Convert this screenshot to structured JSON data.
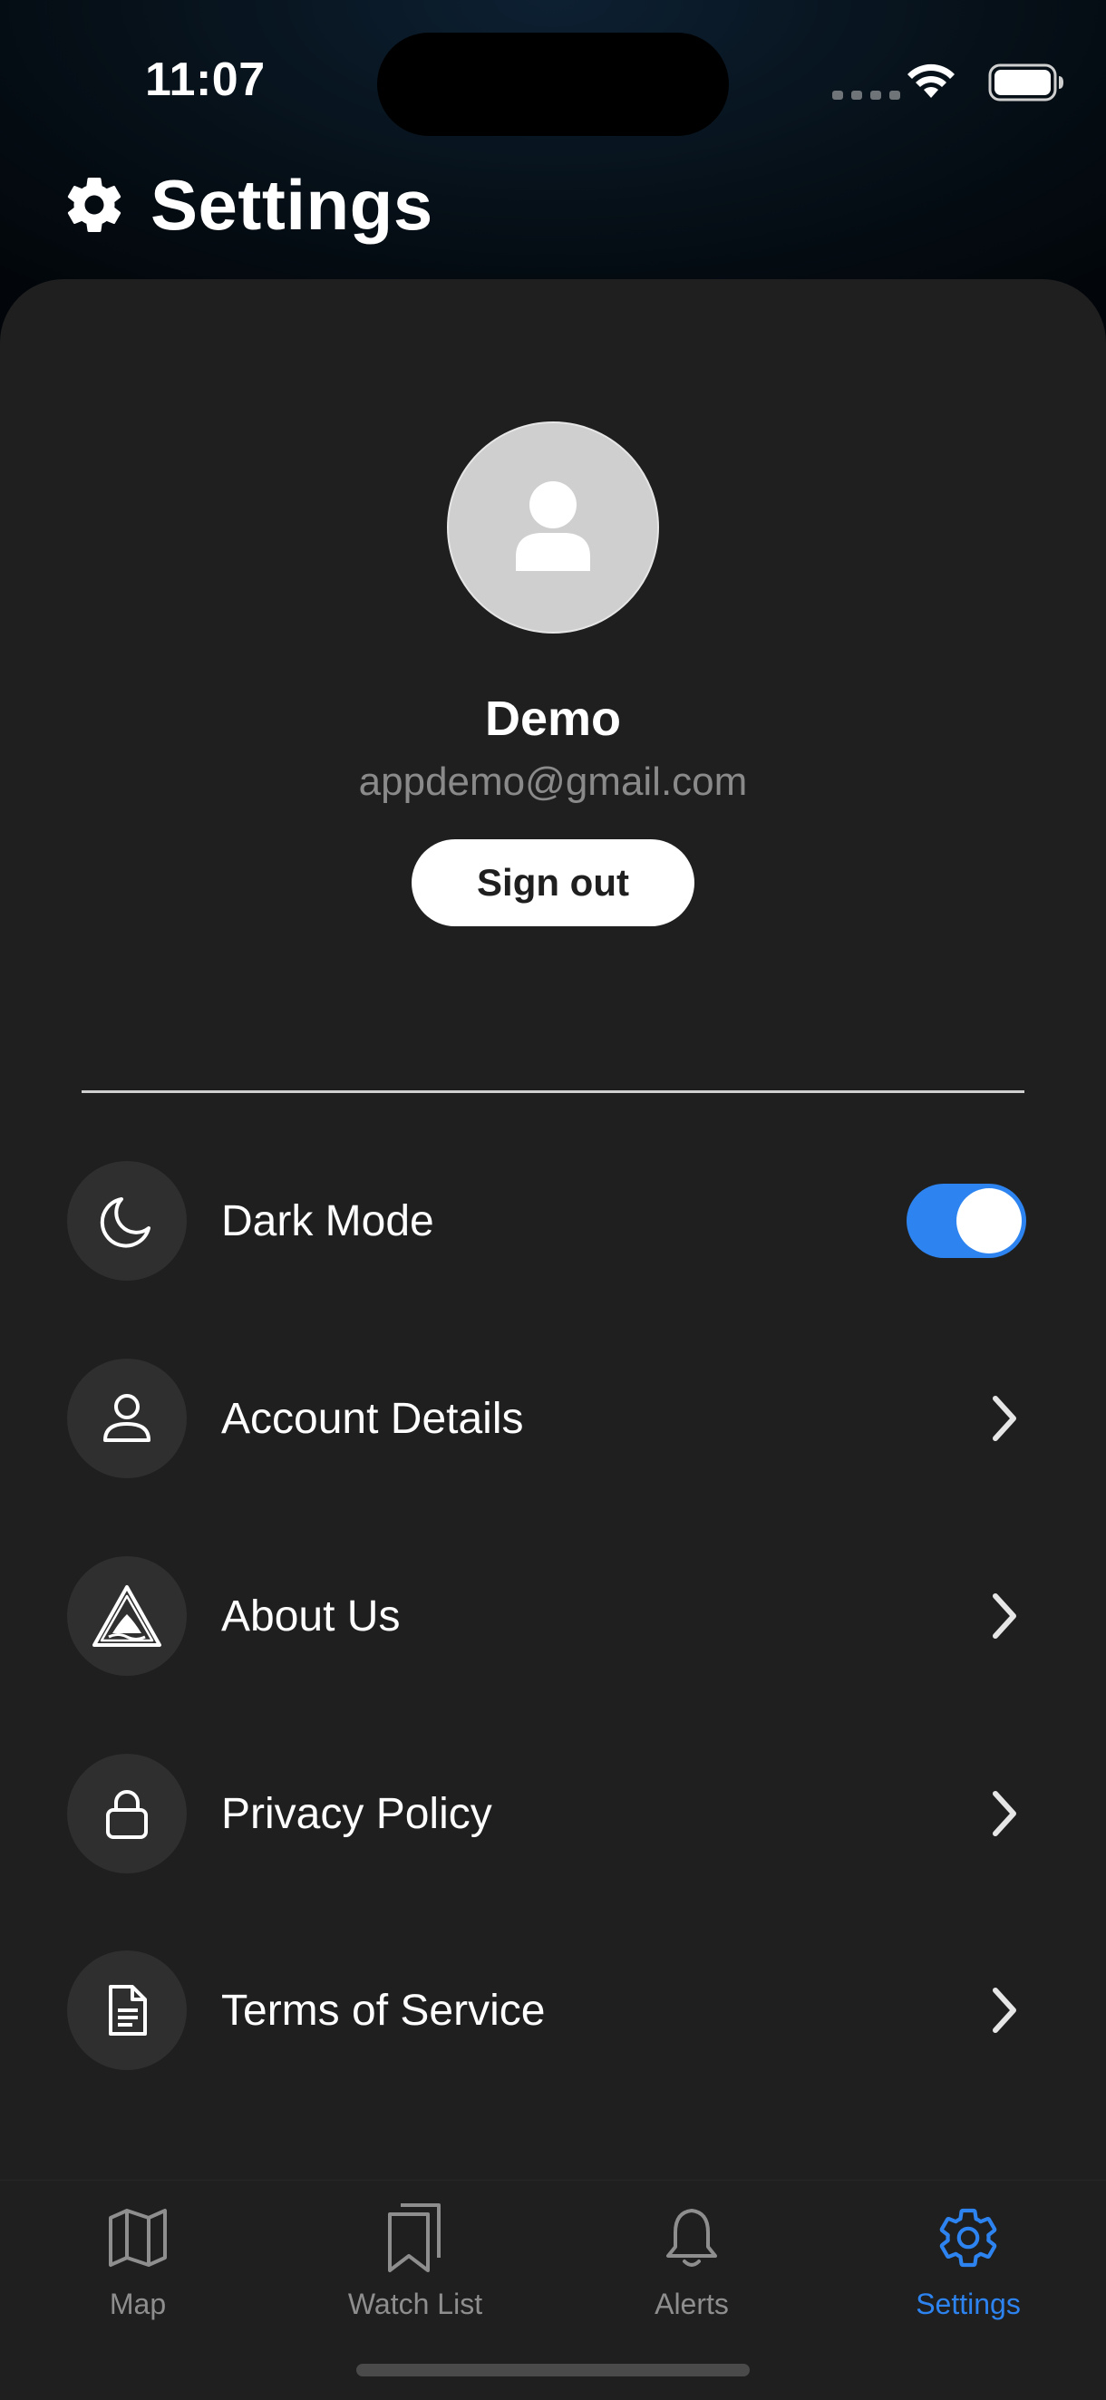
{
  "status_bar": {
    "time": "11:07"
  },
  "header": {
    "title": "Settings",
    "icon": "gear-icon"
  },
  "profile": {
    "name": "Demo",
    "email": "appdemo@gmail.com",
    "sign_out_label": "Sign out",
    "avatar_icon": "user-silhouette-icon"
  },
  "settings": {
    "dark_mode": {
      "label": "Dark Mode",
      "icon": "moon-icon",
      "enabled": true
    },
    "items": [
      {
        "label": "Account Details",
        "icon": "person-icon"
      },
      {
        "label": "About Us",
        "icon": "warning-triangle-icon"
      },
      {
        "label": "Privacy Policy",
        "icon": "lock-icon"
      },
      {
        "label": "Terms of Service",
        "icon": "document-icon"
      }
    ]
  },
  "tabbar": {
    "tabs": [
      {
        "label": "Map",
        "icon": "map-icon",
        "active": false
      },
      {
        "label": "Watch List",
        "icon": "bookmarks-icon",
        "active": false
      },
      {
        "label": "Alerts",
        "icon": "bell-icon",
        "active": false
      },
      {
        "label": "Settings",
        "icon": "gear-icon",
        "active": true
      }
    ]
  },
  "colors": {
    "accent": "#2d84f0",
    "panel": "#1f1f1f",
    "icon_circle": "#2f2f2f",
    "muted_text": "#8a8a8a"
  }
}
